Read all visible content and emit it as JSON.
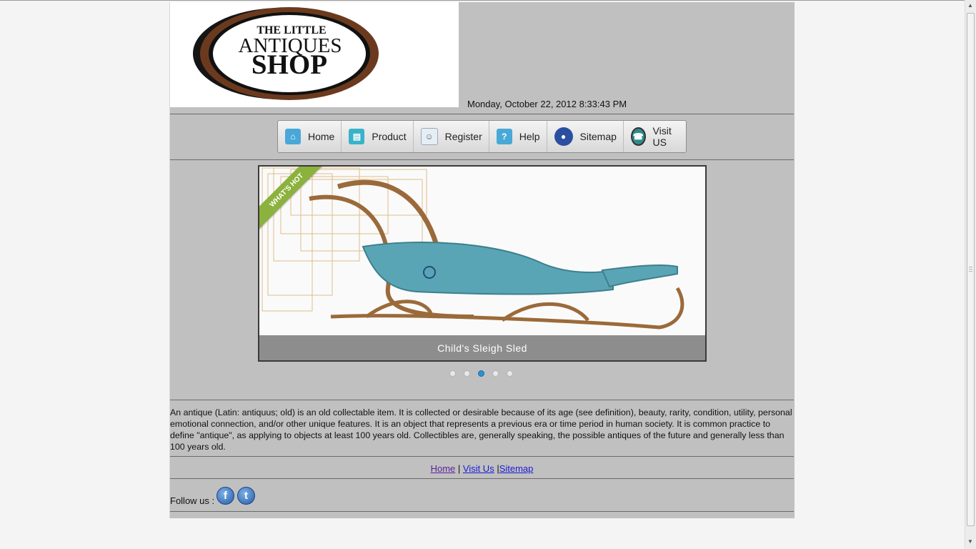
{
  "header": {
    "logo_line1": "THE LITTLE",
    "logo_line2": "ANTIQUES",
    "logo_line3": "SHOP",
    "datetime": "Monday, October 22, 2012 8:33:43 PM"
  },
  "nav": {
    "items": [
      {
        "label": "Home",
        "icon": "home-icon",
        "color": "#4aa8d8"
      },
      {
        "label": "Product",
        "icon": "product-icon",
        "color": "#39b3c9"
      },
      {
        "label": "Register",
        "icon": "register-icon",
        "color": "#8fa6b8"
      },
      {
        "label": "Help",
        "icon": "help-icon",
        "color": "#49a9d6"
      },
      {
        "label": "Sitemap",
        "icon": "sitemap-icon",
        "color": "#2b4fa0"
      },
      {
        "label": "Visit US",
        "icon": "phone-icon",
        "color": "#2e8b8b"
      }
    ]
  },
  "slider": {
    "badge": "WHAT'S HOT",
    "caption": "Child's Sleigh Sled",
    "slide_count": 5,
    "active_index": 2
  },
  "about": {
    "text": "An antique (Latin: antiquus; old) is an old collectable item. It is collected or desirable because of its age (see definition), beauty, rarity, condition, utility, personal emotional connection, and/or other unique features. It is an object that represents a previous era or time period in human society. It is common practice to define \"antique\", as applying to objects at least 100 years old. Collectibles are, generally speaking, the possible antiques of the future and generally less than 100 years old."
  },
  "footer": {
    "home": "Home",
    "sep1": " | ",
    "visit": "Visit Us",
    "sep2": " |",
    "sitemap": "Sitemap",
    "follow": "Follow us :",
    "facebook_glyph": "f",
    "twitter_glyph": "t"
  },
  "colors": {
    "page_bg": "#c0c0c0",
    "logo_brown": "#6b3a1e",
    "active_dot": "#2d8fd0",
    "link": "#1b1bd6"
  }
}
